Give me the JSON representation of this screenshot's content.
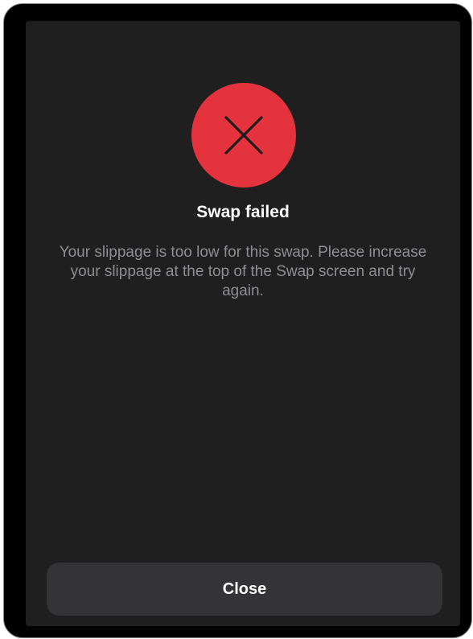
{
  "dialog": {
    "title": "Swap failed",
    "message": "Your slippage is too low for this swap. Please increase your slippage at the top of the Swap screen and try again.",
    "icon": "close-icon",
    "close_label": "Close"
  },
  "colors": {
    "error": "#e5333e",
    "sheet_background": "#1f1f20",
    "button_background": "#343437",
    "message_text": "#8e8e92"
  }
}
